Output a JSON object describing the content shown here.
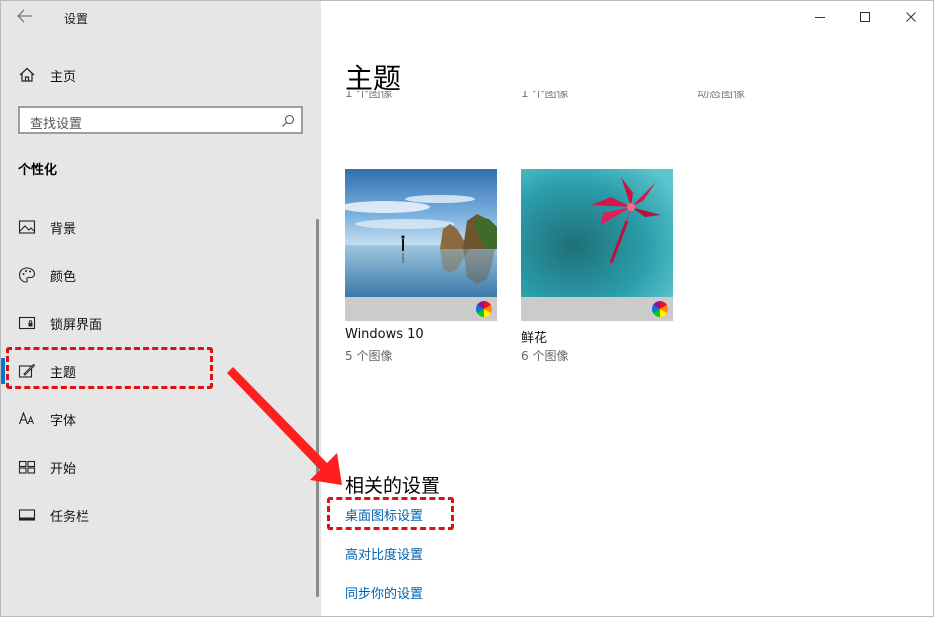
{
  "window": {
    "title": "设置"
  },
  "sidebar": {
    "home_label": "主页",
    "search_placeholder": "查找设置",
    "section_heading": "个性化",
    "items": [
      {
        "label": "背景",
        "icon": "picture-icon"
      },
      {
        "label": "颜色",
        "icon": "palette-icon"
      },
      {
        "label": "锁屏界面",
        "icon": "lock-screen-icon"
      },
      {
        "label": "主题",
        "icon": "theme-brush-icon",
        "selected": true
      },
      {
        "label": "字体",
        "icon": "font-icon"
      },
      {
        "label": "开始",
        "icon": "start-grid-icon"
      },
      {
        "label": "任务栏",
        "icon": "taskbar-icon"
      }
    ]
  },
  "main": {
    "page_title": "主题",
    "cut_captions": [
      "1 个图像",
      "1 个图像",
      "动态图像"
    ],
    "themes": [
      {
        "name": "Windows 10",
        "count": "5 个图像"
      },
      {
        "name": "鲜花",
        "count": "6 个图像"
      }
    ],
    "related": {
      "heading": "相关的设置",
      "links": [
        "桌面图标设置",
        "高对比度设置",
        "同步你的设置"
      ]
    }
  },
  "colors": {
    "accent": "#0078d7",
    "link": "#0063b1",
    "annotation": "#e01010",
    "sidebar_bg": "#e6e6e6"
  }
}
